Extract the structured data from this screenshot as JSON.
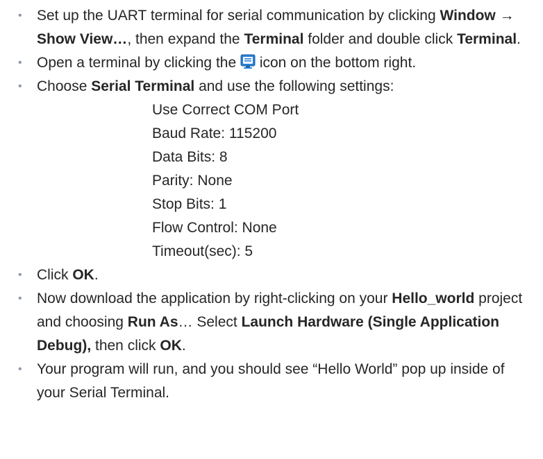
{
  "bullet_glyph": "•",
  "items": [
    {
      "parts": [
        {
          "t": "Set up the UART terminal  for serial communication by clicking "
        },
        {
          "t": "Window → Show View…",
          "b": true
        },
        {
          "t": ", then expand the "
        },
        {
          "t": "Terminal",
          "b": true
        },
        {
          "t": " folder and double click "
        },
        {
          "t": "Terminal",
          "b": true
        },
        {
          "t": "."
        }
      ]
    },
    {
      "parts": [
        {
          "t": "Open a terminal by clicking the "
        },
        {
          "icon": "terminal-monitor-icon"
        },
        {
          "t": " icon on the bottom right."
        }
      ]
    },
    {
      "parts": [
        {
          "t": "Choose "
        },
        {
          "t": "Serial Terminal",
          "b": true
        },
        {
          "t": " and use the following settings:"
        }
      ],
      "settings": [
        "Use Correct COM Port",
        "Baud Rate: 115200",
        "Data Bits: 8",
        "Parity: None",
        "Stop Bits: 1",
        "Flow Control: None",
        "Timeout(sec): 5"
      ]
    },
    {
      "parts": [
        {
          "t": "Click "
        },
        {
          "t": "OK",
          "b": true
        },
        {
          "t": "."
        }
      ]
    },
    {
      "parts": [
        {
          "t": "Now download the application by right-clicking on your "
        },
        {
          "t": "Hello_world",
          "b": true
        },
        {
          "t": " project and choosing "
        },
        {
          "t": "Run As",
          "b": true
        },
        {
          "t": "… Select "
        },
        {
          "t": "Launch Hardware (Single Application Debug),",
          "b": true
        },
        {
          "t": " then click "
        },
        {
          "t": "OK",
          "b": true
        },
        {
          "t": "."
        }
      ]
    },
    {
      "parts": [
        {
          "t": "Your program will run, and you should see “Hello World” pop up inside of your Serial Terminal."
        }
      ]
    }
  ],
  "colors": {
    "text": "#262626",
    "bullet": "#8c9aa8",
    "icon_blue": "#2a7fd4"
  }
}
